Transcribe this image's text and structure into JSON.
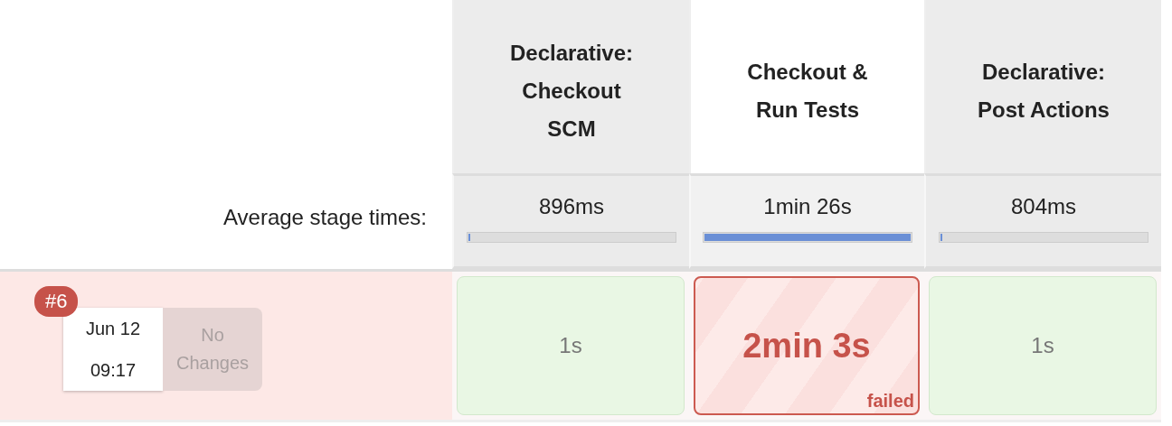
{
  "stages": [
    {
      "name": "Declarative: Checkout SCM",
      "selected": false,
      "average": "896ms",
      "level": 0.01
    },
    {
      "name": "Checkout & Run Tests",
      "selected": true,
      "average": "1min 26s",
      "level": 1
    },
    {
      "name": "Declarative: Post Actions",
      "selected": false,
      "average": "804ms",
      "level": 0.01
    }
  ],
  "average_label": "Average stage times:",
  "builds": [
    {
      "number": "#6",
      "date": "Jun 12",
      "time": "09:17",
      "changes": "No Changes",
      "kind": "failed",
      "cells": [
        {
          "duration": "1s",
          "kind": "success"
        },
        {
          "duration": "2min 3s",
          "kind": "failed",
          "note": "failed"
        },
        {
          "duration": "1s",
          "kind": "success"
        }
      ]
    }
  ]
}
